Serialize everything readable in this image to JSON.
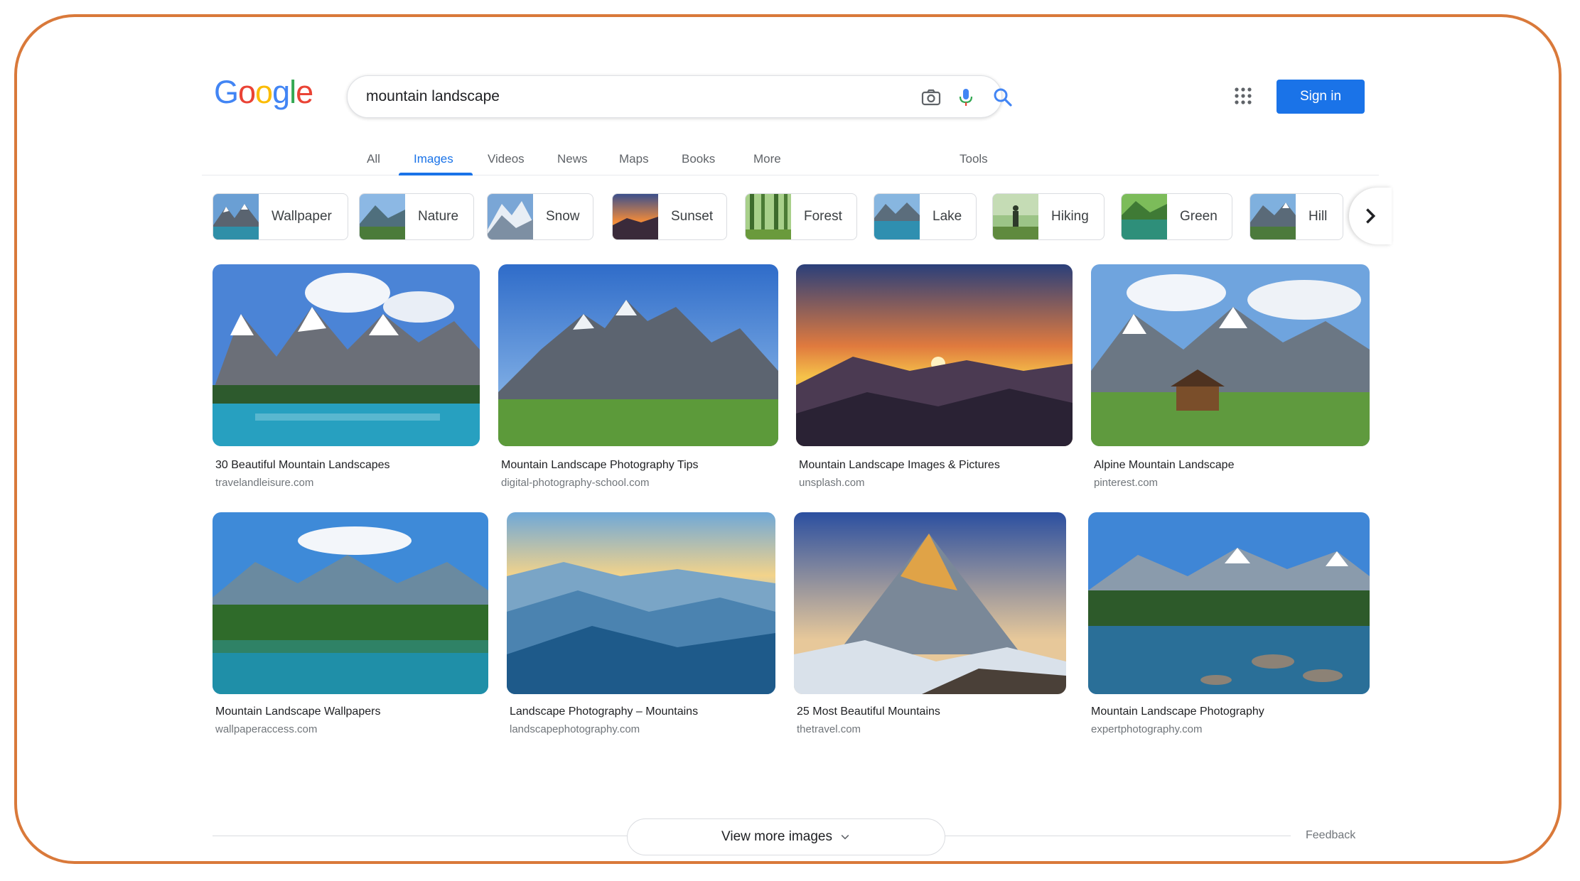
{
  "header": {
    "logo_text": "Google",
    "search_value": "mountain landscape",
    "signin_label": "Sign in"
  },
  "tabs": [
    {
      "label": "All"
    },
    {
      "label": "Images"
    },
    {
      "label": "Videos"
    },
    {
      "label": "News"
    },
    {
      "label": "Maps"
    },
    {
      "label": "Books"
    },
    {
      "label": "More"
    }
  ],
  "tools_label": "Tools",
  "active_tab": "Images",
  "chips": [
    {
      "label": "Wallpaper"
    },
    {
      "label": "Nature"
    },
    {
      "label": "Snow"
    },
    {
      "label": "Sunset"
    },
    {
      "label": "Forest"
    },
    {
      "label": "Lake"
    },
    {
      "label": "Hiking"
    },
    {
      "label": "Green"
    },
    {
      "label": "Hill"
    }
  ],
  "results": [
    {
      "title": "30 Beautiful Mountain Landscapes",
      "source": "travelandleisure.com"
    },
    {
      "title": "Mountain Landscape Photography Tips",
      "source": "digital-photography-school.com"
    },
    {
      "title": "Mountain Landscape Images & Pictures",
      "source": "unsplash.com"
    },
    {
      "title": "Alpine Mountain Landscape",
      "source": "pinterest.com"
    },
    {
      "title": "Mountain Landscape Wallpapers",
      "source": "wallpaperaccess.com"
    },
    {
      "title": "Landscape Photography – Mountains",
      "source": "landscapephotography.com"
    },
    {
      "title": "25 Most Beautiful Mountains",
      "source": "thetravel.com"
    },
    {
      "title": "Mountain Landscape Photography",
      "source": "expertphotography.com"
    }
  ],
  "footer": {
    "more_label": "View more images",
    "feedback_label": "Feedback"
  },
  "colors": {
    "frame_border": "#d9793a",
    "accent_blue": "#1a73e8",
    "logo_blue": "#4285f4",
    "logo_red": "#ea4335",
    "logo_yellow": "#fbbc05",
    "logo_green": "#34a853"
  },
  "icons": [
    "camera-icon",
    "microphone-icon",
    "search-icon",
    "apps-grid-icon",
    "chevron-right-icon",
    "chevron-down-icon"
  ]
}
